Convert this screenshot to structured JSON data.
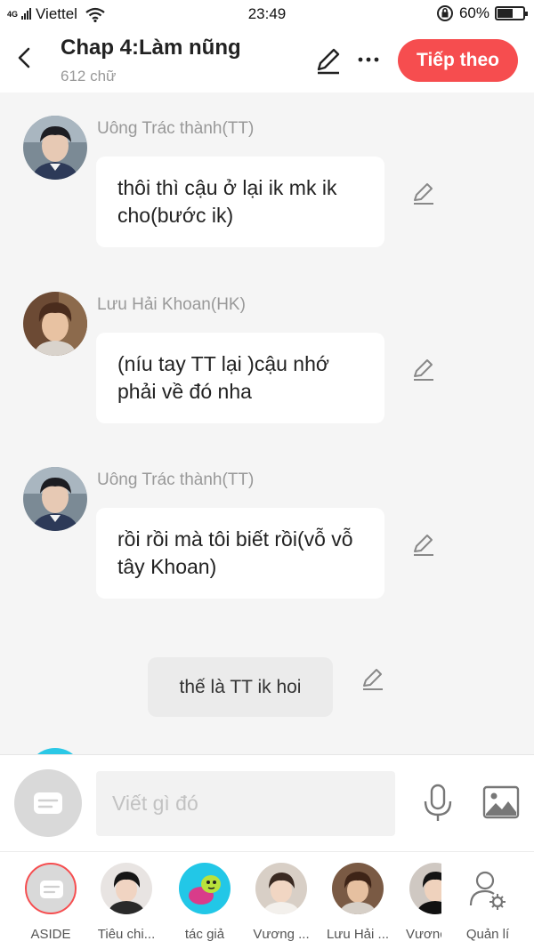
{
  "status_bar": {
    "network": "4G",
    "carrier": "Viettel",
    "time": "23:49",
    "battery": "60%",
    "battery_level": 0.6
  },
  "header": {
    "title": "Chap 4:Làm nũng",
    "subtitle": "612 chữ",
    "next_label": "Tiếp theo"
  },
  "messages": [
    {
      "sender": "Uông Trác thành(TT)",
      "text": "thôi thì cậu ở lại ik mk ik cho(bước ik)",
      "avatar": "boy-dark"
    },
    {
      "sender": "Lưu Hải Khoan(HK)",
      "text": "(níu tay TT lại )cậu nhớ phải về đó nha",
      "avatar": "boy-warm"
    },
    {
      "sender": "Uông Trác thành(TT)",
      "text": "rồi rồi mà tôi biết rồi(vỗ vỗ tây Khoan)",
      "avatar": "boy-dark"
    }
  ],
  "narration": {
    "text": "thế là TT ik hoi"
  },
  "input": {
    "placeholder": "Viết gì đó"
  },
  "characters": [
    {
      "label": "ASIDE"
    },
    {
      "label": "Tiêu chi..."
    },
    {
      "label": "tác giả"
    },
    {
      "label": "Vương ..."
    },
    {
      "label": "Lưu Hải ..."
    },
    {
      "label": "Vươnç"
    }
  ],
  "manage": {
    "label": "Quản lí"
  },
  "colors": {
    "accent": "#f64d4f",
    "background": "#f5f5f5",
    "bubble": "#ffffff",
    "narration": "#ebebeb"
  }
}
